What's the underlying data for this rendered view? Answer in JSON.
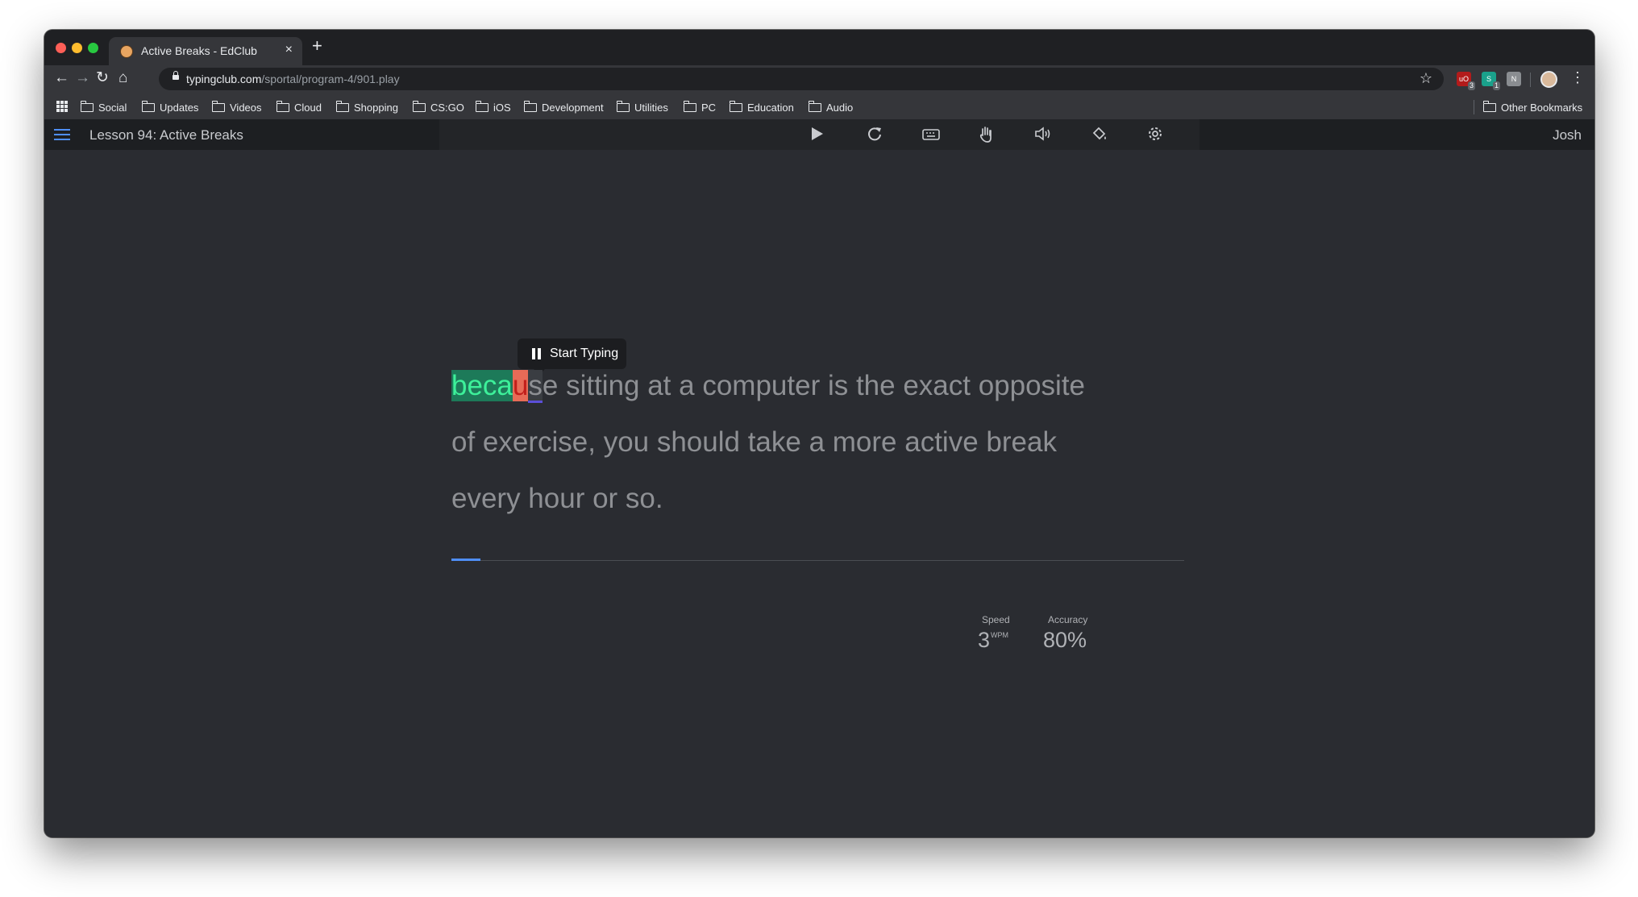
{
  "tab": {
    "title": "Active Breaks - EdClub",
    "close": "×",
    "new_tab": "+"
  },
  "address": {
    "host": "typingclub.com",
    "path": "/sportal/program-4/901.play"
  },
  "extensions": [
    {
      "name": "ublock",
      "badge": "3",
      "color": "#b31b1b"
    },
    {
      "name": "sider",
      "badge": "1",
      "color": "#1aa18b"
    },
    {
      "name": "ext-grey",
      "badge": "",
      "color": "#8a8d91"
    }
  ],
  "bookmarks": [
    {
      "label": "Social"
    },
    {
      "label": "Updates"
    },
    {
      "label": "Videos"
    },
    {
      "label": "Cloud"
    },
    {
      "label": "Shopping"
    },
    {
      "label": "CS:GO"
    },
    {
      "label": "iOS"
    },
    {
      "label": "Development"
    },
    {
      "label": "Utilities"
    },
    {
      "label": "PC"
    },
    {
      "label": "Education"
    },
    {
      "label": "Audio"
    }
  ],
  "other_bookmarks": "Other Bookmarks",
  "lesson": {
    "title": "Lesson 94: Active Breaks",
    "user": "Josh"
  },
  "toolbar_icons": [
    "play-icon",
    "restart-icon",
    "keyboard-icon",
    "hand-icon",
    "sound-icon",
    "theme-icon",
    "settings-icon"
  ],
  "tooltip": {
    "label": "Start Typing"
  },
  "text": {
    "typed": "beca",
    "wrong": "u",
    "cursor": "s",
    "line1_rest": "e sitting at a computer is the exact opposite",
    "line2": "of exercise, you should take a more active break",
    "line3": "every hour or so."
  },
  "stats": {
    "speed_label": "Speed",
    "speed_value": "3",
    "speed_unit": "WPM",
    "accuracy_label": "Accuracy",
    "accuracy_value": "80%"
  },
  "progress": {
    "fraction": 0.04
  },
  "colors": {
    "typed_bg": "#1d7a59",
    "typed_fg": "#3df09a",
    "wrong_bg": "#e76b57",
    "accent": "#4f8ef7"
  }
}
